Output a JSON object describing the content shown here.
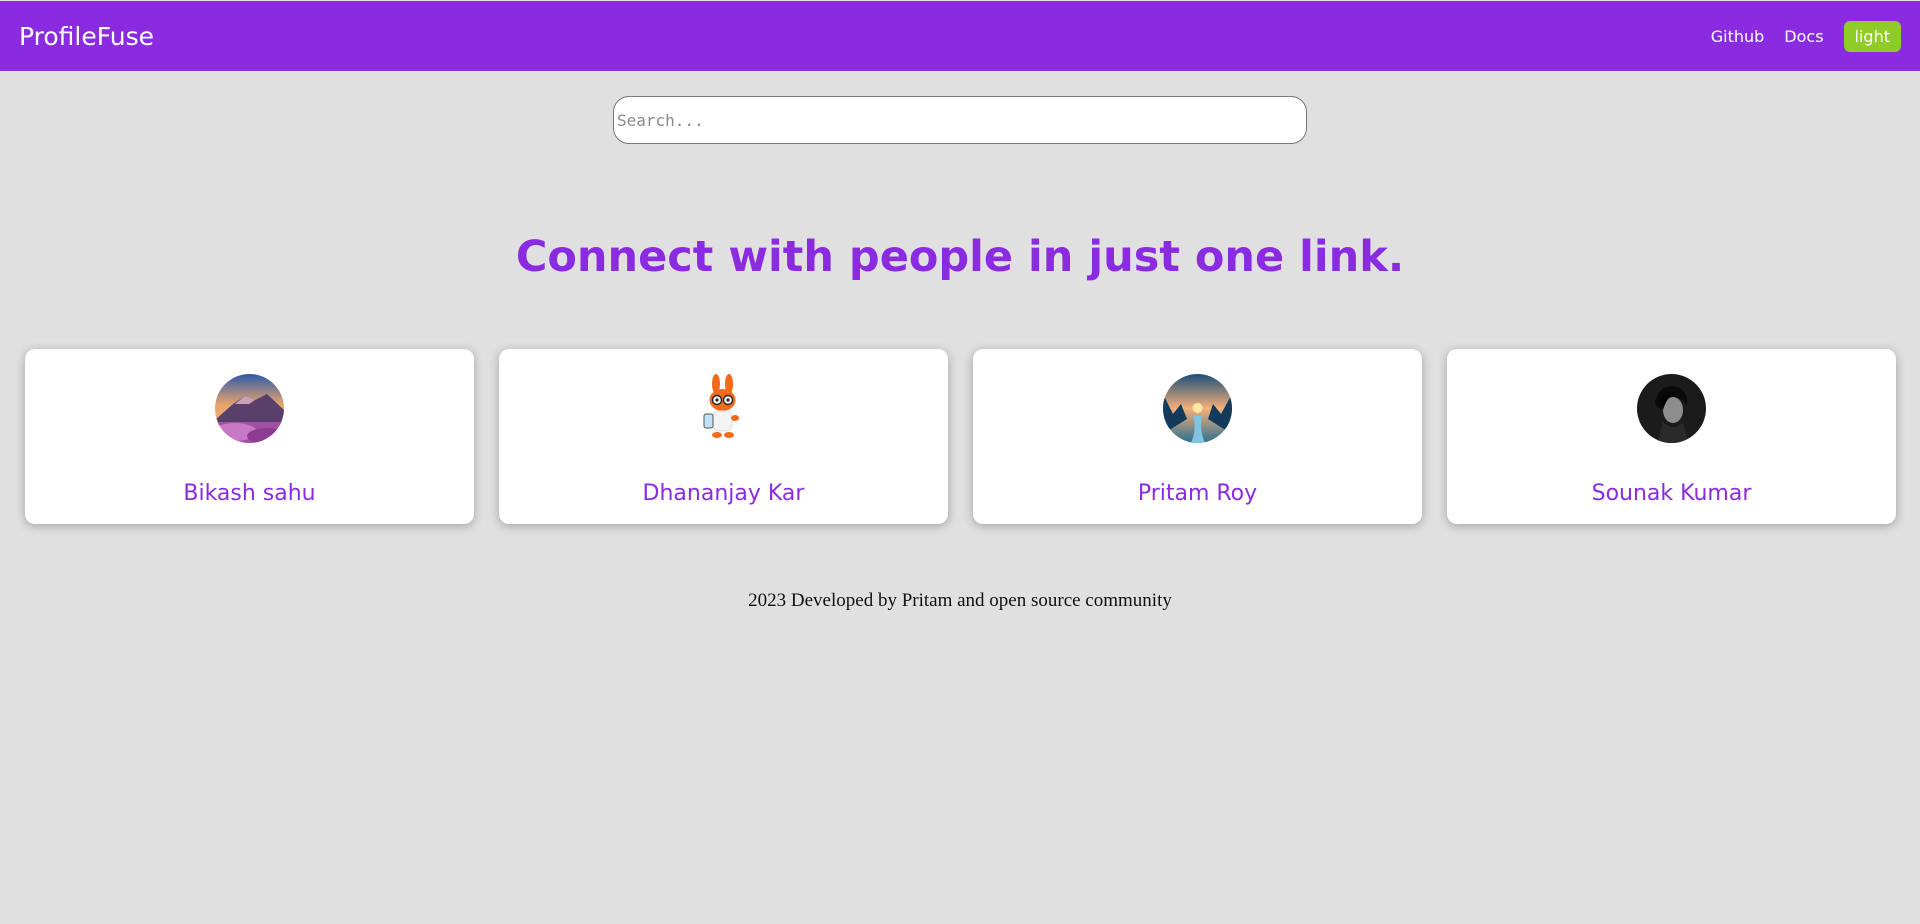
{
  "navbar": {
    "brand": "ProfileFuse",
    "links": [
      "Github",
      "Docs"
    ],
    "theme_button": "light"
  },
  "search": {
    "placeholder": "Search...",
    "value": ""
  },
  "headline": "Connect with people in just one link.",
  "profiles": [
    {
      "name": "Bikash sahu",
      "avatar": "mountain-landscape"
    },
    {
      "name": "Dhananjay Kar",
      "avatar": "cartoon-rabbit"
    },
    {
      "name": "Pritam Roy",
      "avatar": "sunset-valley"
    },
    {
      "name": "Sounak Kumar",
      "avatar": "dark-portrait"
    }
  ],
  "footer": "2023 Developed by Pritam and open source community",
  "colors": {
    "accent": "#8a2be2",
    "theme_button": "#8fcc2a",
    "background": "#e0e0e0"
  }
}
